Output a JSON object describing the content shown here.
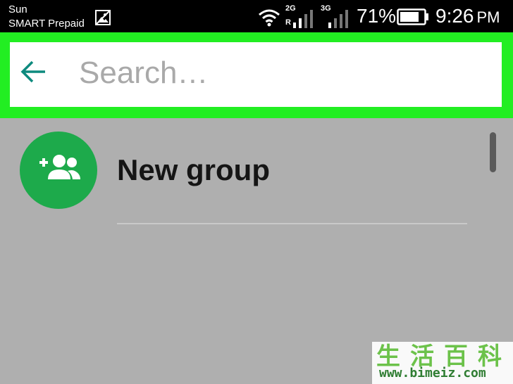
{
  "status_bar": {
    "carrier_line1": "Sun",
    "carrier_line2": "SMART Prepaid",
    "network_1": "2G",
    "network_1_roaming": "R",
    "network_2": "3G",
    "battery": "71%",
    "time": "9:26",
    "ampm": "PM",
    "icons": [
      "gallery-icon",
      "wifi-icon",
      "signal-icon",
      "battery-icon"
    ]
  },
  "search": {
    "value": "",
    "placeholder": "Search…",
    "highlight_color": "#22ee22"
  },
  "list": {
    "items": [
      {
        "label": "New group",
        "icon": "add-group-icon",
        "avatar_color": "#1daa4b"
      }
    ]
  },
  "watermark": {
    "logo_text": "生活百科",
    "url": "www.bimeiz.com"
  },
  "colors": {
    "accent": "#0e8a7e",
    "overlay_bg": "#afafaf"
  }
}
